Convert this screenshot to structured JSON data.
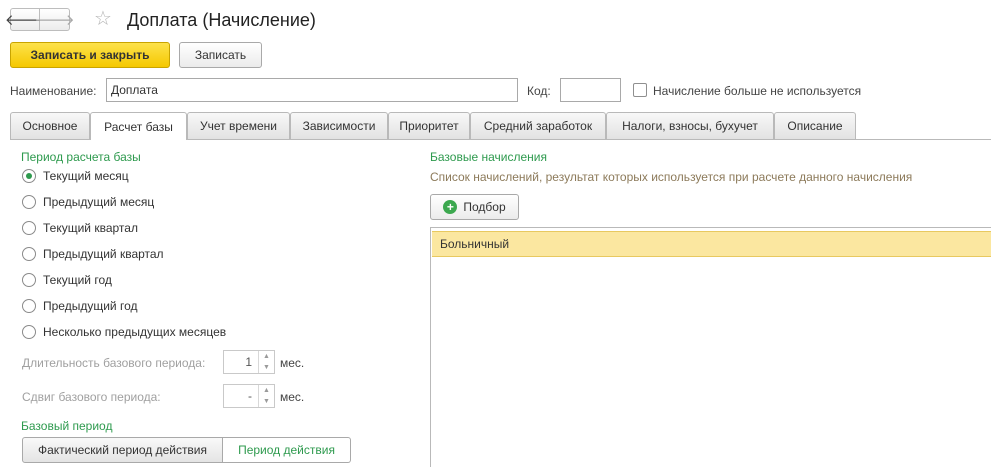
{
  "header": {
    "back_icon": "arrow-left-icon",
    "forward_icon": "arrow-right-icon",
    "back_glyph": "🡐",
    "forward_glyph": "🡒",
    "star_glyph": "☆",
    "title": "Доплата (Начисление)"
  },
  "toolbar": {
    "save_close_label": "Записать и закрыть",
    "save_label": "Записать"
  },
  "form": {
    "name_label": "Наименование:",
    "name_value": "Доплата",
    "code_label": "Код:",
    "code_value": "",
    "unused_label": "Начисление больше не используется",
    "unused_checked": false
  },
  "tabs": [
    {
      "label": "Основное",
      "active": false
    },
    {
      "label": "Расчет базы",
      "active": true
    },
    {
      "label": "Учет времени",
      "active": false
    },
    {
      "label": "Зависимости",
      "active": false
    },
    {
      "label": "Приоритет",
      "active": false
    },
    {
      "label": "Средний заработок",
      "active": false
    },
    {
      "label": "Налоги, взносы, бухучет",
      "active": false
    },
    {
      "label": "Описание",
      "active": false
    }
  ],
  "period": {
    "title": "Период расчета базы",
    "options": [
      {
        "label": "Текущий месяц",
        "checked": true
      },
      {
        "label": "Предыдущий месяц",
        "checked": false
      },
      {
        "label": "Текущий квартал",
        "checked": false
      },
      {
        "label": "Предыдущий квартал",
        "checked": false
      },
      {
        "label": "Текущий год",
        "checked": false
      },
      {
        "label": "Предыдущий год",
        "checked": false
      },
      {
        "label": "Несколько предыдущих месяцев",
        "checked": false
      }
    ],
    "duration_label": "Длительность базового периода:",
    "duration_value": "1",
    "duration_unit": "мес.",
    "shift_label": "Сдвиг базового периода:",
    "shift_value": "-",
    "shift_unit": "мес."
  },
  "base_period": {
    "title": "Базовый период",
    "option_actual": "Фактический период действия",
    "option_period": "Период действия",
    "selected": "Период действия"
  },
  "base_accruals": {
    "title": "Базовые начисления",
    "description": "Список начислений, результат которых используется при расчете данного начисления",
    "pick_label": "Подбор",
    "items": [
      "Больничный"
    ]
  },
  "colors": {
    "accent_green": "#2e9a4e",
    "primary_yellow": "#f5c800",
    "selected_row": "#fbe7a0"
  }
}
